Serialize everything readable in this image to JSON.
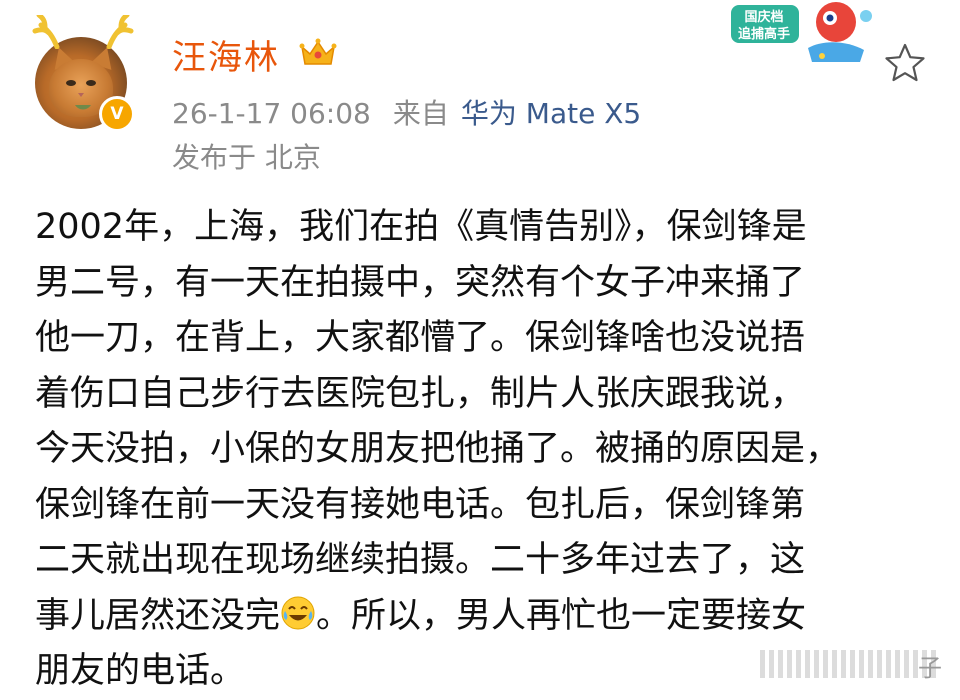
{
  "user": {
    "name": "汪海林",
    "verified_badge": "V"
  },
  "meta": {
    "timestamp": "26-1-17 06:08",
    "source_prefix": "来自",
    "device": "华为 Mate X5",
    "location": "发布于 北京"
  },
  "promo": {
    "line1": "国庆档",
    "line2": "追捕高手"
  },
  "post": {
    "lines": [
      "2002年，上海，我们在拍《真情告别》，保剑锋是",
      "男二号，有一天在拍摄中，突然有个女子冲来捅了",
      "他一刀，在背上，大家都懵了。保剑锋啥也没说捂",
      "着伤口自己步行去医院包扎，制片人张庆跟我说，",
      "今天没拍，小保的女朋友把他捅了。被捅的原因是，",
      "保剑锋在前一天没有接她电话。包扎后，保剑锋第",
      "二天就出现在现场继续拍摄。二十多年过去了，这",
      "事儿居然还没完",
      "。所以，男人再忙也一定要接女",
      "朋友的电话。"
    ]
  },
  "watermark": {
    "text": "子"
  },
  "colors": {
    "username": "#e8560b",
    "badge": "#f7a600",
    "meta": "#8a8a8a",
    "device": "#3a5a8c",
    "text": "#111111"
  },
  "icons": [
    "crown-icon",
    "verified-badge-icon",
    "star-icon",
    "laugh-cry-emoji-icon"
  ]
}
